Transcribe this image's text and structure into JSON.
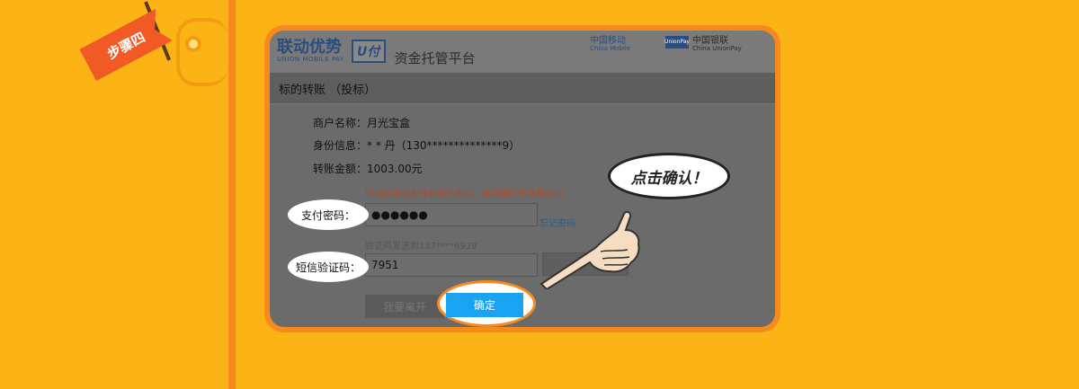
{
  "step_label": "步骤四",
  "header": {
    "logo_cn": "联动优势",
    "logo_en": "UNION MOBILE PAY",
    "u_badge": "U付",
    "platform": "资金托管平台",
    "china_mobile_cn": "中国移动",
    "china_mobile_en": "China Mobile",
    "unionpay_cn": "中国银联",
    "unionpay_en": "China UnionPay",
    "unionpay_card": "UnionPay"
  },
  "subhead": "标的转账 （投标）",
  "info": {
    "merchant": "商户名称：月光宝盒",
    "identity": "身份信息：* * 丹（130**************9）",
    "amount": "转账金额：1003.00元"
  },
  "password_notice": "联动优势资金托管支付密码，非您银行卡交易密码",
  "password_label": "支付密码：",
  "password_value": "●●●●●●",
  "forgot_link": "忘记密码",
  "sms_notice": "验证码发送到137****6939",
  "sms_label": "短信验证码：",
  "sms_value": "7951",
  "leave_button": "我要离开",
  "confirm_button": "确定",
  "callout": "点击确认！"
}
